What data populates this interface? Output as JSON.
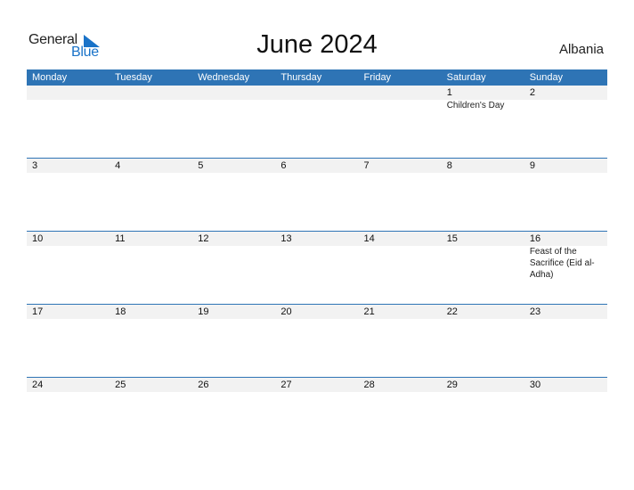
{
  "logo": {
    "general": "General",
    "blue": "Blue"
  },
  "title": "June 2024",
  "country": "Albania",
  "weekdays": [
    "Monday",
    "Tuesday",
    "Wednesday",
    "Thursday",
    "Friday",
    "Saturday",
    "Sunday"
  ],
  "weeks": [
    [
      {
        "day": ""
      },
      {
        "day": ""
      },
      {
        "day": ""
      },
      {
        "day": ""
      },
      {
        "day": ""
      },
      {
        "day": "1",
        "event": "Children's Day"
      },
      {
        "day": "2"
      }
    ],
    [
      {
        "day": "3"
      },
      {
        "day": "4"
      },
      {
        "day": "5"
      },
      {
        "day": "6"
      },
      {
        "day": "7"
      },
      {
        "day": "8"
      },
      {
        "day": "9"
      }
    ],
    [
      {
        "day": "10"
      },
      {
        "day": "11"
      },
      {
        "day": "12"
      },
      {
        "day": "13"
      },
      {
        "day": "14"
      },
      {
        "day": "15"
      },
      {
        "day": "16",
        "event": "Feast of the Sacrifice (Eid al-Adha)"
      }
    ],
    [
      {
        "day": "17"
      },
      {
        "day": "18"
      },
      {
        "day": "19"
      },
      {
        "day": "20"
      },
      {
        "day": "21"
      },
      {
        "day": "22"
      },
      {
        "day": "23"
      }
    ],
    [
      {
        "day": "24"
      },
      {
        "day": "25"
      },
      {
        "day": "26"
      },
      {
        "day": "27"
      },
      {
        "day": "28"
      },
      {
        "day": "29"
      },
      {
        "day": "30"
      }
    ]
  ],
  "colors": {
    "accent": "#2e74b5",
    "band": "#f2f2f2",
    "logo_blue": "#1a73c8"
  }
}
